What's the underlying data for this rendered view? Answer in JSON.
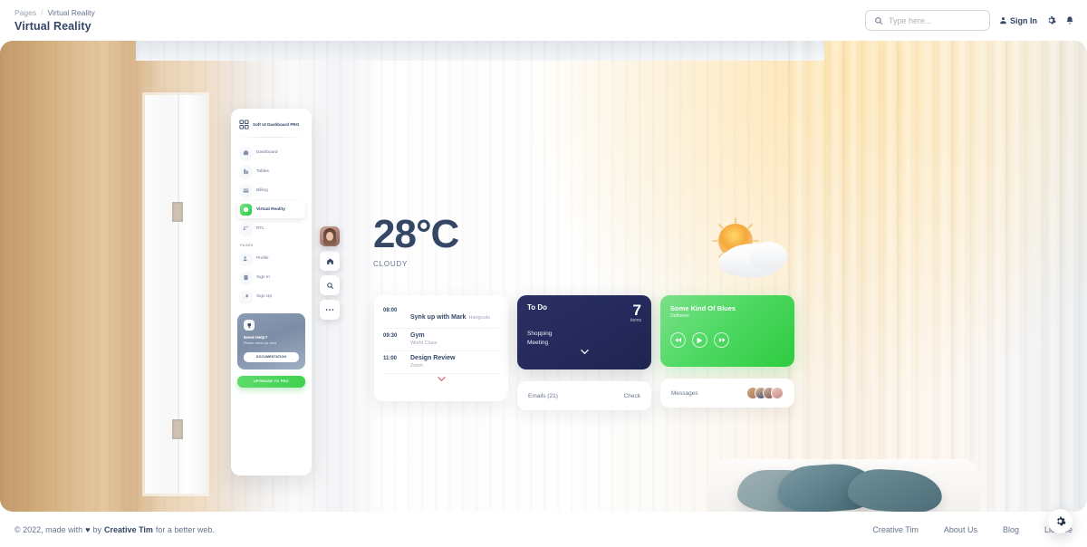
{
  "header": {
    "breadcrumb_root": "Pages",
    "breadcrumb_sep": "/",
    "breadcrumb_current": "Virtual Reality",
    "title": "Virtual Reality",
    "search_placeholder": "Type here...",
    "search_value": "",
    "signin_label": "Sign In",
    "icons": {
      "search": "search-icon",
      "user": "user-icon",
      "settings": "gear-icon",
      "notifications": "bell-icon"
    }
  },
  "sidebar": {
    "brand": "Soft UI Dashboard PRO",
    "items": [
      {
        "label": "Dashboard",
        "icon": "shop-icon",
        "active": false
      },
      {
        "label": "Tables",
        "icon": "office-icon",
        "active": false
      },
      {
        "label": "Billing",
        "icon": "credit-card-icon",
        "active": false
      },
      {
        "label": "Virtual Reality",
        "icon": "box-3d-icon",
        "active": true
      },
      {
        "label": "RTL",
        "icon": "rtl-icon",
        "active": false
      }
    ],
    "section_label": "PAGES",
    "page_items": [
      {
        "label": "Profile",
        "icon": "profile-icon"
      },
      {
        "label": "Sign In",
        "icon": "document-icon"
      },
      {
        "label": "Sign Up",
        "icon": "rocket-icon"
      }
    ],
    "help_card": {
      "icon": "cup-icon",
      "title": "Need Help?",
      "subtitle": "Please check our docs",
      "button_label": "DOCUMENTATION"
    },
    "upgrade_label": "UPGRADE TO PRO"
  },
  "rail": {
    "avatar": "user-avatar",
    "buttons": [
      {
        "name": "home-icon"
      },
      {
        "name": "search-icon"
      },
      {
        "name": "ellipsis-icon"
      }
    ]
  },
  "weather": {
    "temperature": "28°C",
    "condition": "CLOUDY",
    "icon": "sun-behind-cloud-icon"
  },
  "schedule": {
    "rows": [
      {
        "time": "08:00",
        "title": "Synk up with Mark",
        "meta": "Hangouts",
        "meta_inline": true
      },
      {
        "time": "09:30",
        "title": "Gym",
        "meta": "World Class",
        "meta_inline": false
      },
      {
        "time": "11:00",
        "title": "Design Review",
        "meta": "Zoom",
        "meta_inline": false
      }
    ],
    "expand_icon": "chevron-down-icon"
  },
  "todo": {
    "title": "To Do",
    "count": "7",
    "count_label": "items",
    "items": [
      "Shopping",
      "Meeting"
    ],
    "expand_icon": "chevron-down-icon"
  },
  "emails": {
    "label": "Emails (21)",
    "action": "Check"
  },
  "music": {
    "title": "Some Kind Of Blues",
    "artist": "Deftones",
    "controls": [
      "rewind-icon",
      "play-icon",
      "forward-icon"
    ]
  },
  "messages": {
    "label": "Messages",
    "avatar_count": 4
  },
  "footer": {
    "copyright_prefix": "© 2022, made with",
    "heart": "♥",
    "by": "by",
    "brand": "Creative Tim",
    "suffix": "for a better web.",
    "links": [
      "Creative Tim",
      "About Us",
      "Blog",
      "License"
    ],
    "fab_icon": "gear-icon"
  },
  "colors": {
    "accent_green": "#3fd14f",
    "dark_navy": "#252a5c",
    "text_dark": "#344767",
    "text_muted": "#67748e"
  }
}
